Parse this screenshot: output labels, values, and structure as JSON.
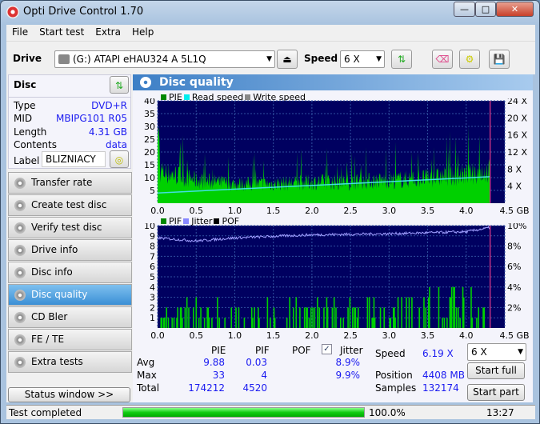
{
  "window": {
    "title": "Opti Drive Control 1.70"
  },
  "menu": [
    "File",
    "Start test",
    "Extra",
    "Help"
  ],
  "toolbar": {
    "drive_label": "Drive",
    "drive_value": "(G:)  ATAPI eHAU324   A 5L1Q",
    "speed_label": "Speed",
    "speed_value": "6 X"
  },
  "disc": {
    "header": "Disc",
    "type_k": "Type",
    "type_v": "DVD+R",
    "mid_k": "MID",
    "mid_v": "MBIPG101 R05",
    "length_k": "Length",
    "length_v": "4.31 GB",
    "contents_k": "Contents",
    "contents_v": "data",
    "label_k": "Label",
    "label_v": "BLIZNIACY"
  },
  "nav": [
    "Transfer rate",
    "Create test disc",
    "Verify test disc",
    "Drive info",
    "Disc info",
    "Disc quality",
    "CD Bler",
    "FE / TE",
    "Extra tests"
  ],
  "nav_active": 5,
  "status_window": "Status window >>",
  "panel": {
    "title": "Disc quality"
  },
  "chart_data": [
    {
      "type": "bar",
      "legend": [
        "PIE",
        "Read speed",
        "Write speed"
      ],
      "colors": {
        "PIE": "#00e000",
        "Read speed": "#00e0e0",
        "Write speed": "#888888"
      },
      "xlim": [
        0,
        4.5
      ],
      "xunit": "GB",
      "x_ticks": [
        "0.0",
        "0.5",
        "1.0",
        "1.5",
        "2.0",
        "2.5",
        "3.0",
        "3.5",
        "4.0",
        "4.5 GB"
      ],
      "ylim": [
        0,
        40
      ],
      "y_ticks": [
        "5",
        "10",
        "15",
        "20",
        "25",
        "30",
        "35",
        "40"
      ],
      "y2_ticks": [
        "4 X",
        "8 X",
        "12 X",
        "16 X",
        "20 X",
        "24 X"
      ],
      "pie_max": 33,
      "pie_typical": [
        [
          0,
          17
        ],
        [
          0.5,
          12
        ],
        [
          1.0,
          10
        ],
        [
          1.5,
          10
        ],
        [
          2.0,
          11
        ],
        [
          2.5,
          11
        ],
        [
          3.0,
          12
        ],
        [
          3.5,
          13
        ],
        [
          4.0,
          15
        ],
        [
          4.31,
          17
        ]
      ],
      "read_speed_x": [
        [
          0,
          2.4
        ],
        [
          4.31,
          6.2
        ]
      ]
    },
    {
      "type": "bar",
      "legend": [
        "PIF",
        "Jitter",
        "POF"
      ],
      "colors": {
        "PIF": "#00e000",
        "Jitter": "#8080ff",
        "POF": "#000000"
      },
      "xlim": [
        0,
        4.5
      ],
      "x_ticks": [
        "0.0",
        "0.5",
        "1.0",
        "1.5",
        "2.0",
        "2.5",
        "3.0",
        "3.5",
        "4.0",
        "4.5 GB"
      ],
      "ylim": [
        0,
        10
      ],
      "y_ticks": [
        "1",
        "2",
        "3",
        "4",
        "5",
        "6",
        "7",
        "8",
        "9",
        "10"
      ],
      "y2_ticks": [
        "2%",
        "4%",
        "6%",
        "8%",
        "10%"
      ],
      "pif_max": 4,
      "jitter_pct": [
        [
          0,
          8.8
        ],
        [
          0.5,
          8.5
        ],
        [
          1.0,
          8.8
        ],
        [
          2.0,
          9.1
        ],
        [
          3.0,
          9.2
        ],
        [
          4.0,
          9.4
        ],
        [
          4.31,
          9.8
        ]
      ]
    }
  ],
  "stats": {
    "cols": [
      "PIE",
      "PIF",
      "POF",
      "Jitter"
    ],
    "jitter_checked": true,
    "rows": [
      {
        "k": "Avg",
        "pie": "9.88",
        "pif": "0.03",
        "jit": "8.9%"
      },
      {
        "k": "Max",
        "pie": "33",
        "pif": "4",
        "jit": "9.9%"
      },
      {
        "k": "Total",
        "pie": "174212",
        "pif": "4520",
        "jit": ""
      }
    ],
    "speed_k": "Speed",
    "speed_v": "6.19 X",
    "position_k": "Position",
    "position_v": "4408 MB",
    "samples_k": "Samples",
    "samples_v": "132174"
  },
  "controls": {
    "speed": "6 X",
    "start_full": "Start full",
    "start_part": "Start part"
  },
  "status": {
    "text": "Test completed",
    "progress": 100.0,
    "progress_text": "100.0%",
    "time": "13:27"
  }
}
